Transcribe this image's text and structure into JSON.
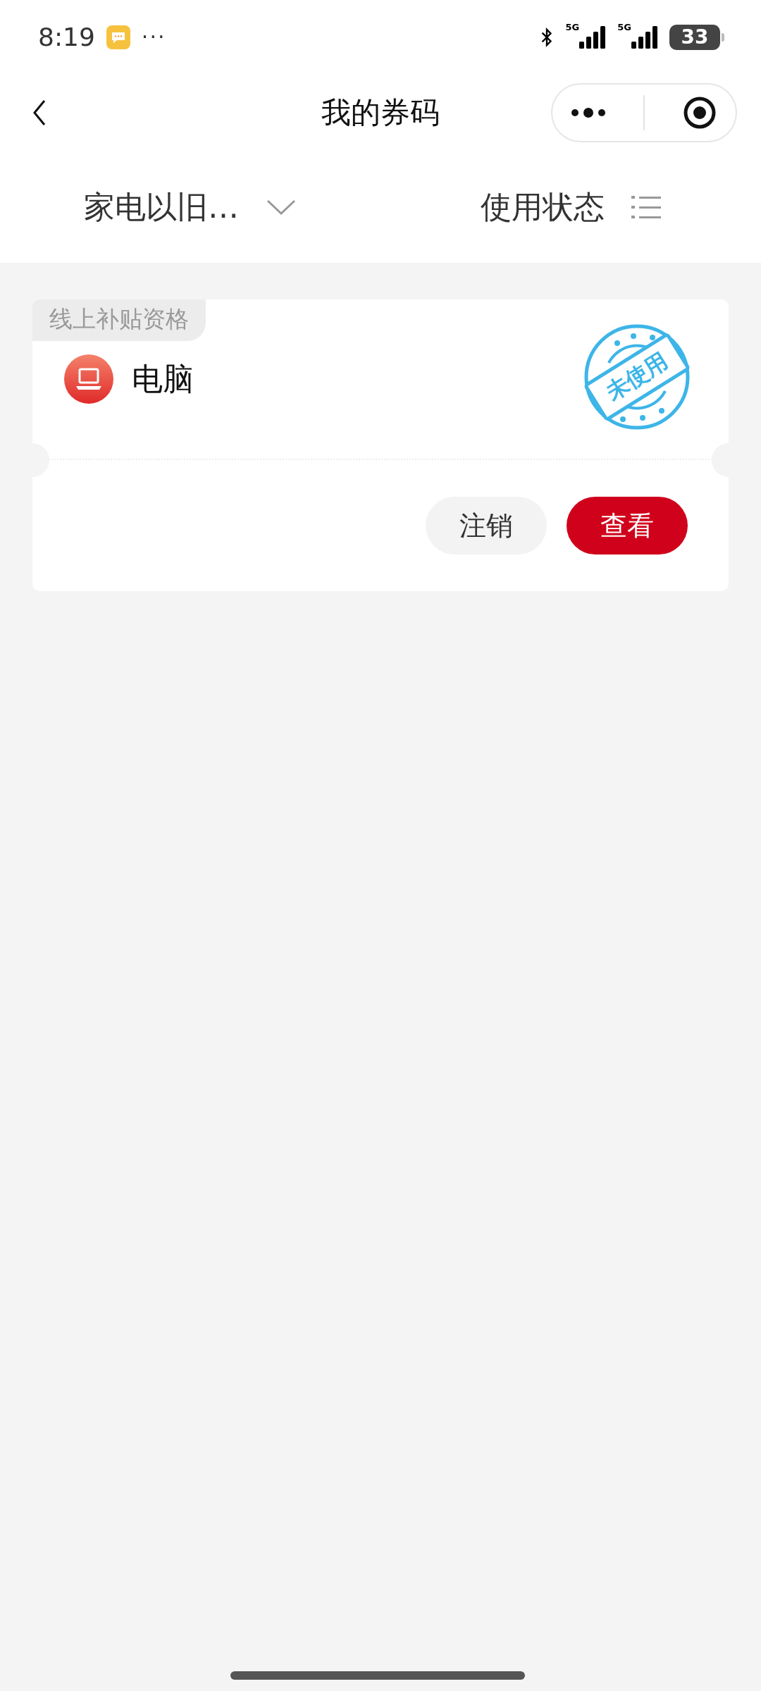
{
  "status_bar": {
    "time": "8:19",
    "more": "···",
    "network_labels": [
      "5G",
      "5G"
    ],
    "battery": "33"
  },
  "nav": {
    "title": "我的券码"
  },
  "filters": [
    {
      "label": "家电以旧…",
      "kind": "dropdown"
    },
    {
      "label": "使用状态",
      "kind": "list"
    }
  ],
  "coupons": [
    {
      "tag": "线上补贴资格",
      "name": "电脑",
      "status": "未使用",
      "buttons": [
        {
          "label": "注销",
          "kind": "secondary"
        },
        {
          "label": "查看",
          "kind": "primary"
        }
      ]
    }
  ]
}
